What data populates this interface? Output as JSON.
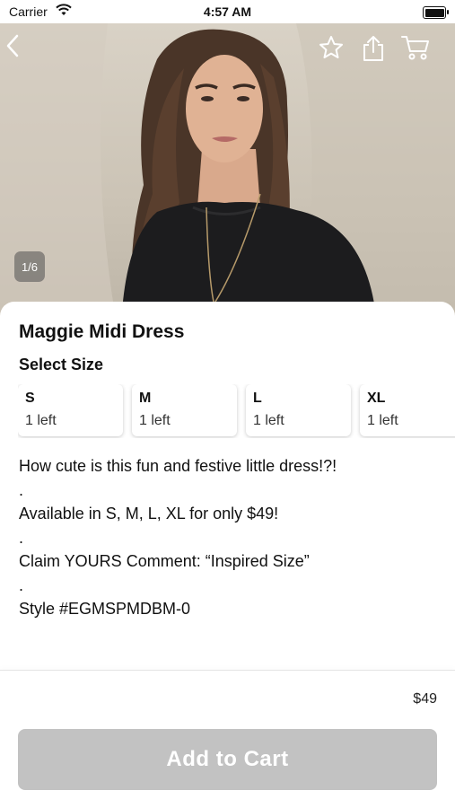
{
  "status_bar": {
    "carrier": "Carrier",
    "time": "4:57 AM"
  },
  "hero": {
    "image_counter": "1/6"
  },
  "product": {
    "title": "Maggie Midi Dress",
    "select_size_label": "Select Size",
    "sizes": [
      {
        "label": "S",
        "stock": "1 left"
      },
      {
        "label": "M",
        "stock": "1 left"
      },
      {
        "label": "L",
        "stock": "1 left"
      },
      {
        "label": "XL",
        "stock": "1 left"
      }
    ],
    "description_lines": [
      "How cute is this fun and festive little dress!?!",
      ".",
      "Available in S, M, L, XL for only $49!",
      ".",
      "Claim YOURS Comment: “Inspired Size”",
      ".",
      "Style #EGMSPMDBM-0"
    ]
  },
  "footer": {
    "price": "$49",
    "add_to_cart_label": "Add to Cart"
  },
  "icons": {
    "back": "chevron-left-icon",
    "favorite": "star-icon",
    "share": "share-icon",
    "cart": "cart-icon"
  },
  "colors": {
    "button_disabled": "#c2c2c2",
    "text": "#111111"
  }
}
